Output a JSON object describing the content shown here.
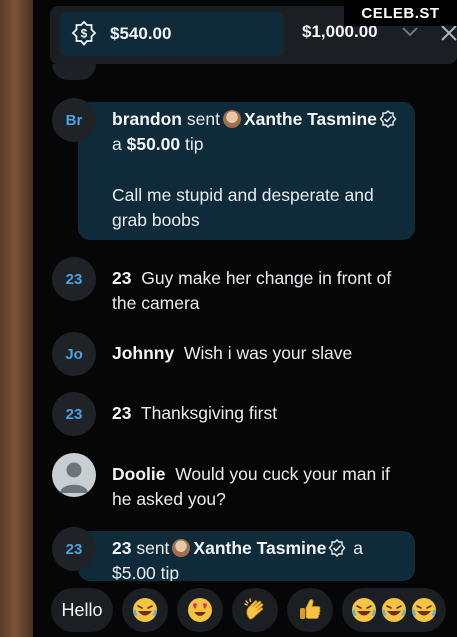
{
  "watermark": "CELEB.ST",
  "tipbar": {
    "tip_amount": "$540.00",
    "goal_amount": "$1,000.00",
    "tip_icon": "dollar-badge-icon",
    "chevron_icon": "chevron-down-icon",
    "close_icon": "close-icon"
  },
  "messages": [
    {
      "avatar": "Br",
      "user": "brandon",
      "action": "sent",
      "recipient": "Xanthe Tasmine",
      "connector": "a",
      "amount": "$50.00",
      "suffix": "tip",
      "text": "Call me stupid and desperate and grab boobs"
    },
    {
      "avatar": "23",
      "user": "23",
      "text": "Guy make her change in front of the camera"
    },
    {
      "avatar": "Jo",
      "user": "Johnny",
      "text": "Wish i was your slave"
    },
    {
      "avatar": "23",
      "user": "23",
      "text": "Thanksgiving first"
    },
    {
      "avatar": "",
      "user": "Doolie",
      "text": "Would you cuck your man if he asked you?"
    },
    {
      "avatar": "23",
      "user": "23",
      "action": "sent",
      "recipient": "Xanthe Tasmine",
      "connector": "a",
      "amount_line": "$5.00 tip"
    }
  ],
  "quick_replies": {
    "hello": "Hello",
    "items": [
      "laughing-emoji",
      "heart-eyes-emoji",
      "clapping-hand-emoji",
      "thumbs-up-emoji",
      "triple-laughing-emoji"
    ]
  },
  "colors": {
    "tip_bubble": "#0f2a39",
    "avatar_bg": "#1f2327",
    "initials": "#4aa3df",
    "chip_bg": "#1b1e22"
  }
}
